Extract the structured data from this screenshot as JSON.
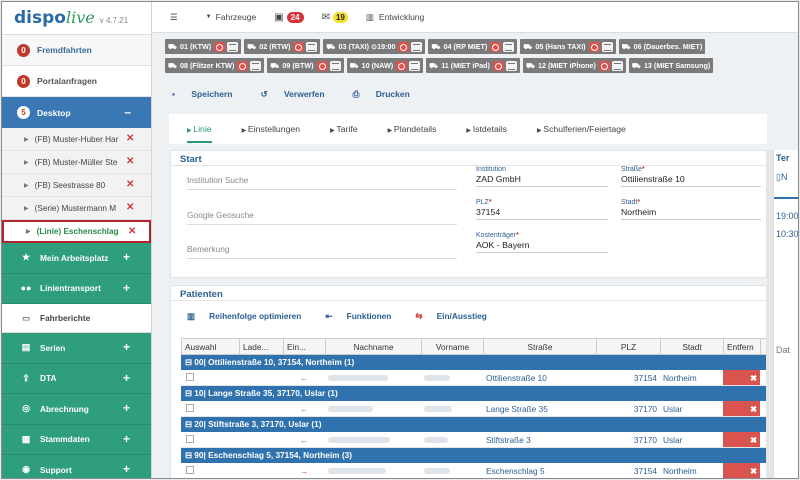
{
  "app": {
    "logo_a": "dispo",
    "logo_b": "live",
    "version": "v 4.7.21"
  },
  "sidebar": {
    "fremdfahrten": {
      "count": "0",
      "label": "Fremdfahrten"
    },
    "portal": {
      "count": "0",
      "label": "Portalanfragen"
    },
    "desktop": {
      "count": "5",
      "label": "Desktop",
      "toggle": "–"
    },
    "desktop_items": [
      {
        "label": "(FB) Muster-Huber Har"
      },
      {
        "label": "(FB) Muster-Müller Ste"
      },
      {
        "label": "(FB) Seestrasse 80"
      },
      {
        "label": "(Serie) Mustermann M"
      },
      {
        "label": "(Linie) Eschenschlag 5"
      }
    ],
    "menu": [
      {
        "label": "Mein Arbeitsplatz",
        "icon": "star-icon"
      },
      {
        "label": "Linientransport",
        "icon": "users-icon"
      },
      {
        "label": "Fahrberichte",
        "icon": "folder-icon"
      },
      {
        "label": "Serien",
        "icon": "list-icon"
      },
      {
        "label": "DTA",
        "icon": "upload-icon"
      },
      {
        "label": "Abrechnung",
        "icon": "coins-icon"
      },
      {
        "label": "Stammdaten",
        "icon": "table-icon"
      },
      {
        "label": "Support",
        "icon": "lifebuoy-icon"
      }
    ]
  },
  "topbar": {
    "menu_icon": "☰",
    "vehicles": "Fahrzeuge",
    "alerts": "24",
    "messages": "19",
    "dev": "Entwicklung"
  },
  "vehicles": [
    [
      "01 (KTW)",
      "02 (RTW)",
      "03 (TAXI) ⊙19:00",
      "04 (RP MIET)",
      "05 (Hans TAXI)",
      "06 (Dauerbes. MIET)"
    ],
    [
      "08 (Flitzer KTW)",
      "09 (BTW)",
      "10 (NAW)",
      "11 (MIET iPad)",
      "12 (MIET iPhone)",
      "13 (MIET Samsung)"
    ]
  ],
  "actions": {
    "save": "Speichern",
    "discard": "Verwerfen",
    "print": "Drucken"
  },
  "tabs": [
    "Linie",
    "Einstellungen",
    "Tarife",
    "Plandetails",
    "Istdetails",
    "Schulferien/Feiertage"
  ],
  "start": {
    "title": "Start",
    "placeholders": [
      "Institution Suche",
      "Google Geosuche",
      "Bemerkung"
    ],
    "institution": {
      "label": "Institution",
      "value": "ZAD GmbH"
    },
    "strasse": {
      "label": "Straße",
      "value": "Ottilienstraße 10"
    },
    "plz": {
      "label": "PLZ",
      "value": "37154"
    },
    "stadt": {
      "label": "Stadt",
      "value": "Northeim"
    },
    "kosten": {
      "label": "Kostenträger",
      "value": "AOK - Bayern"
    }
  },
  "patients": {
    "title": "Patienten",
    "tools": [
      "Reihenfolge optimieren",
      "Funktionen",
      "Ein/Ausstieg"
    ],
    "columns": [
      "Auswahl",
      "Lade...",
      "Ein...",
      "Nachname",
      "Vorname",
      "Straße",
      "PLZ",
      "Stadt",
      "Entfern"
    ],
    "groups": [
      {
        "label": "00| Ottilienstraße 10, 37154, Northeim (1)",
        "strasse": "Ottilienstraße 10",
        "plz": "37154",
        "stadt": "Northeim",
        "dir": "←"
      },
      {
        "label": "10| Lange Straße 35, 37170, Uslar (1)",
        "strasse": "Lange Straße 35",
        "plz": "37170",
        "stadt": "Uslar",
        "dir": "←"
      },
      {
        "label": "20| Stiftstraße 3, 37170, Uslar (1)",
        "strasse": "Stiftstraße 3",
        "plz": "37170",
        "stadt": "Uslar",
        "dir": "←"
      },
      {
        "label": "90| Eschenschlag 5, 37154, Northeim (3)",
        "strasse": "Eschenschlag 5",
        "plz": "37154",
        "stadt": "Northeim",
        "dir": "→"
      }
    ]
  },
  "right": {
    "title": "Ter",
    "r1": "N",
    "t1": "19:00",
    "t2": "10:30",
    "d": "Dat"
  }
}
